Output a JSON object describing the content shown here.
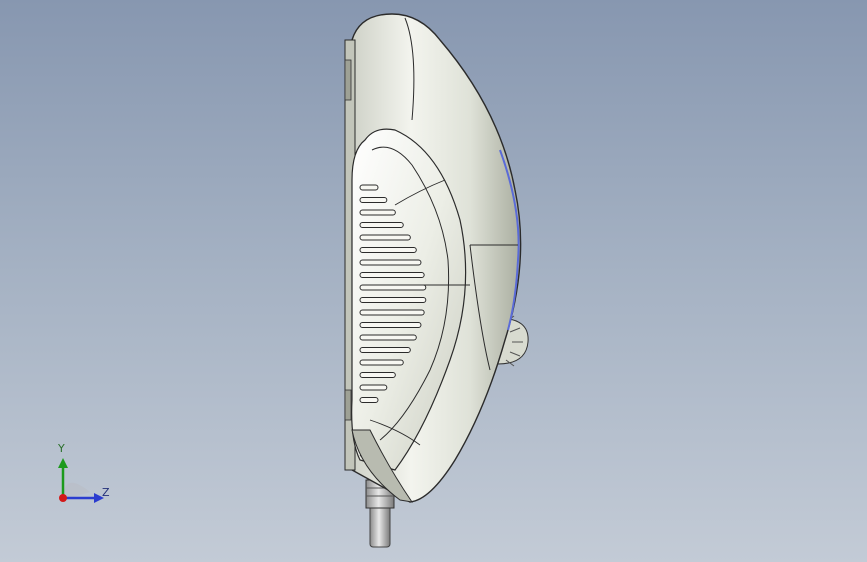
{
  "viewport": {
    "background_top": "#8797b0",
    "background_bottom": "#c3cbd6"
  },
  "model": {
    "description_icon": "handheld-pendant-model",
    "shell_color": "#e6e9e0",
    "grip_color": "#f2f3ec",
    "edge_color": "#2b2b2b",
    "highlight_color": "#5a6bd8",
    "slot_count": 18
  },
  "triad": {
    "y_label": "Y",
    "z_label": "Z",
    "y_color": "#1c9a1c",
    "z_color": "#2a3ccf",
    "x_color": "#d21818"
  }
}
